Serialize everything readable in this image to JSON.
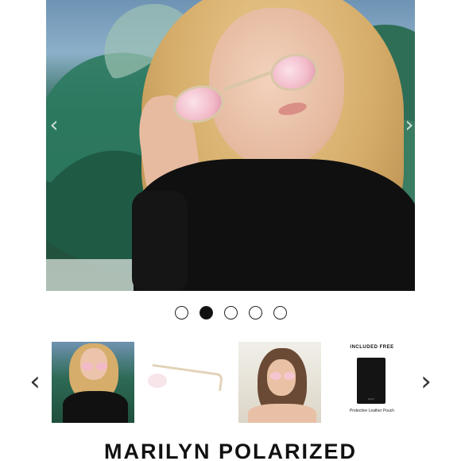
{
  "gallery": {
    "main_image_icon": "model-wearing-pink-mirrored-sunglasses",
    "prev_icon": "‹",
    "next_icon": "›",
    "active_index": 1,
    "slide_count": 5
  },
  "thumbnails": {
    "prev_icon": "‹",
    "next_icon": "›",
    "items": [
      {
        "icon": "model-blonde-sunglasses-photo"
      },
      {
        "icon": "sunglasses-side-view-photo"
      },
      {
        "icon": "model-brunette-sunglasses-photo"
      },
      {
        "icon": "leather-pouch-photo",
        "header": "INCLUDED FREE",
        "brand": "QUAY",
        "caption": "Protective Leather Pouch"
      }
    ]
  },
  "product": {
    "title": "MARILYN POLARIZED"
  },
  "colors": {
    "lens_pink": "#f2b9c8",
    "frame_gold": "#d9c7a8",
    "text": "#111111"
  }
}
